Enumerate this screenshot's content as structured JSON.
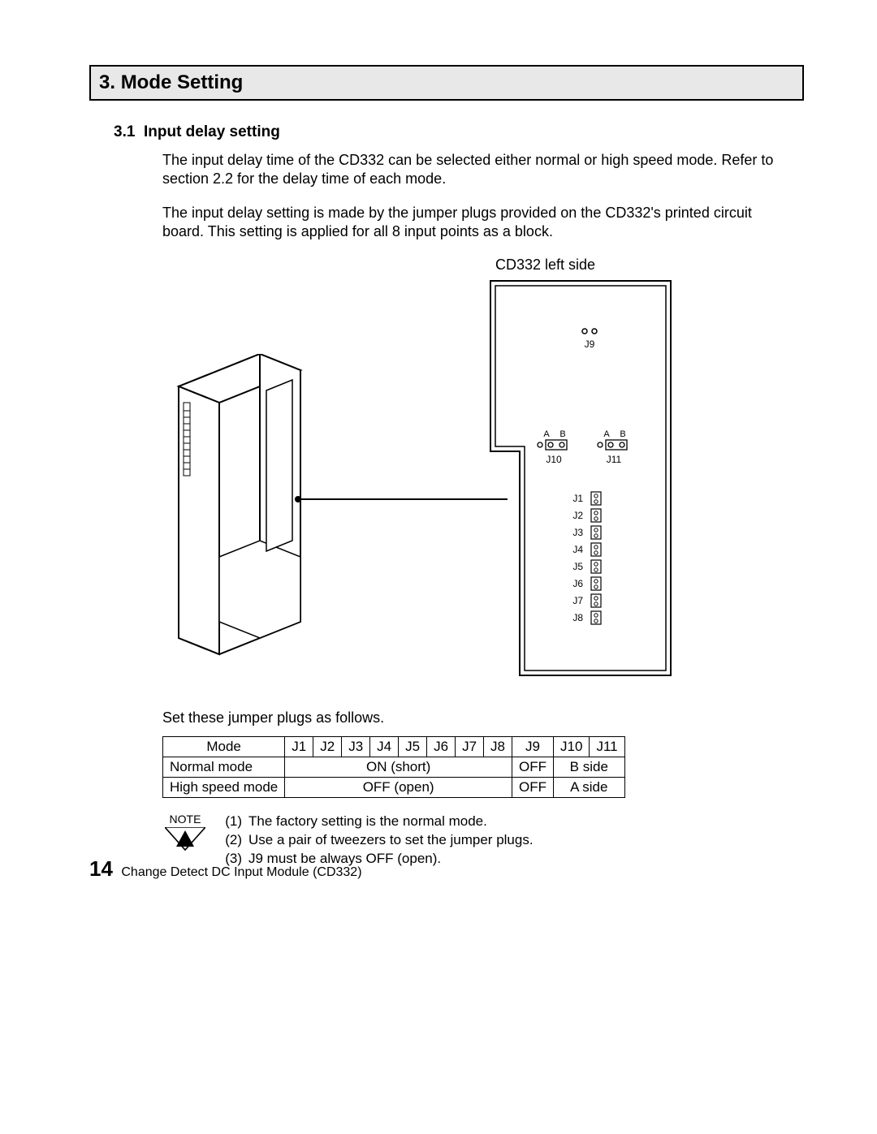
{
  "section": {
    "number": "3.",
    "title": "Mode Setting"
  },
  "subsection": {
    "number": "3.1",
    "title": "Input delay setting"
  },
  "paragraphs": {
    "p1": "The input delay time of the CD332 can be selected either normal or high speed mode. Refer to section 2.2 for the delay time of each mode.",
    "p2": "The input delay setting is made by the jumper plugs provided on the CD332's printed circuit board. This setting is applied for all 8 input points as a block."
  },
  "diagram": {
    "caption": "CD332 left side",
    "jumper_top": {
      "label": "J9"
    },
    "ab_left": {
      "a": "A",
      "b": "B",
      "label": "J10"
    },
    "ab_right": {
      "a": "A",
      "b": "B",
      "label": "J11"
    },
    "jrows": [
      "J1",
      "J2",
      "J3",
      "J4",
      "J5",
      "J6",
      "J7",
      "J8"
    ]
  },
  "set_text": "Set these jumper plugs as follows.",
  "table": {
    "headers": [
      "Mode",
      "J1",
      "J2",
      "J3",
      "J4",
      "J5",
      "J6",
      "J7",
      "J8",
      "J9",
      "J10",
      "J11"
    ],
    "rows": [
      {
        "mode": "Normal mode",
        "j1_8": "ON (short)",
        "j9": "OFF",
        "j10_11": "B side"
      },
      {
        "mode": "High speed mode",
        "j1_8": "OFF (open)",
        "j9": "OFF",
        "j10_11": "A side"
      }
    ]
  },
  "note": {
    "label": "NOTE",
    "items": [
      {
        "n": "(1)",
        "t": "The factory setting is the normal mode."
      },
      {
        "n": "(2)",
        "t": "Use a pair of tweezers to set the jumper plugs."
      },
      {
        "n": "(3)",
        "t": "J9 must be always OFF (open)."
      }
    ]
  },
  "footer": {
    "page": "14",
    "title": "Change Detect DC Input Module (CD332)"
  }
}
